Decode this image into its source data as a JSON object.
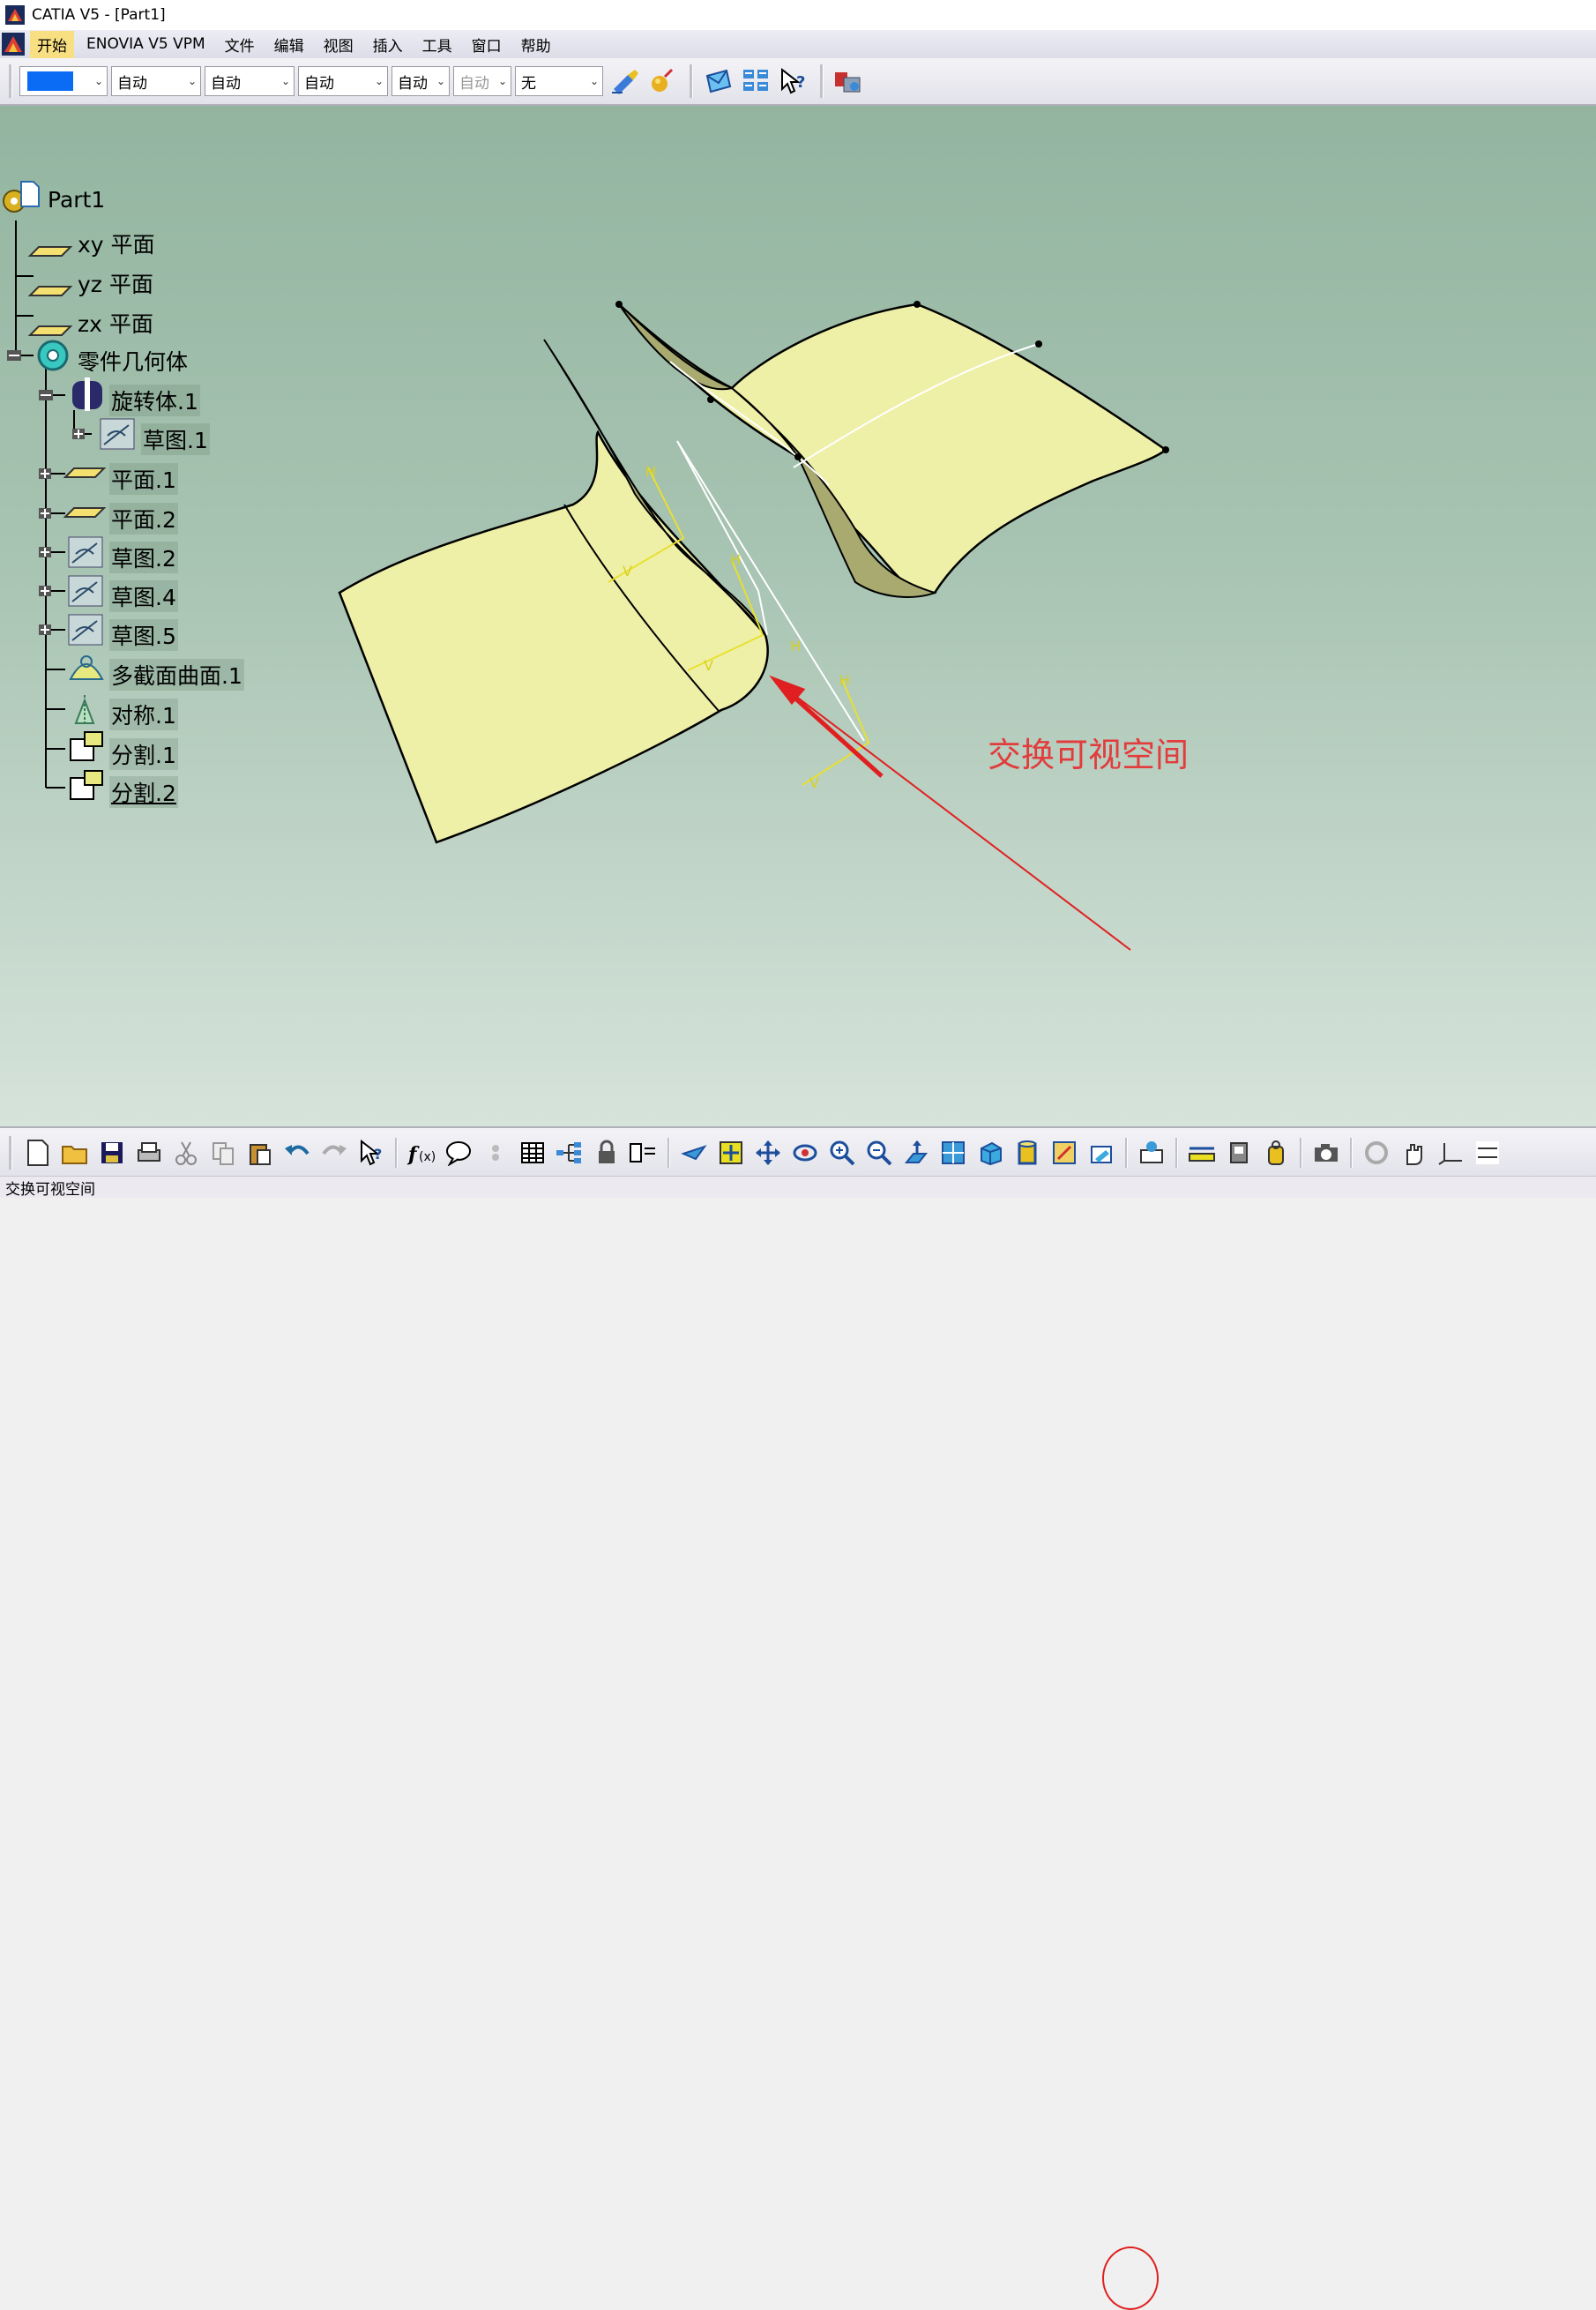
{
  "window": {
    "title": "CATIA V5 - [Part1]"
  },
  "menu": {
    "items": [
      "开始",
      "ENOVIA V5 VPM",
      "文件",
      "编辑",
      "视图",
      "插入",
      "工具",
      "窗口",
      "帮助"
    ]
  },
  "properties_toolbar": {
    "color_value": "#0a6cf5",
    "combo1": "自动",
    "combo2": "自动",
    "combo3": "自动",
    "combo4": "自动",
    "combo5": "自动",
    "combo6": "无"
  },
  "tree": {
    "root": "Part1",
    "nodes": [
      "xy 平面",
      "yz 平面",
      "zx 平面",
      "零件几何体",
      "旋转体.1",
      "草图.1",
      "平面.1",
      "平面.2",
      "草图.2",
      "草图.4",
      "草图.5",
      "多截面曲面.1",
      "对称.1",
      "分割.1",
      "分割.2"
    ]
  },
  "annotation": {
    "text": "交换可视空间",
    "color": "#e23c3c"
  },
  "sketch_labels": {
    "h": "H",
    "v": "V"
  },
  "status": {
    "text": "交换可视空间"
  },
  "colors": {
    "surface": "#eef0a8",
    "accent": "#e02020",
    "background_top": "#93b5a0"
  }
}
